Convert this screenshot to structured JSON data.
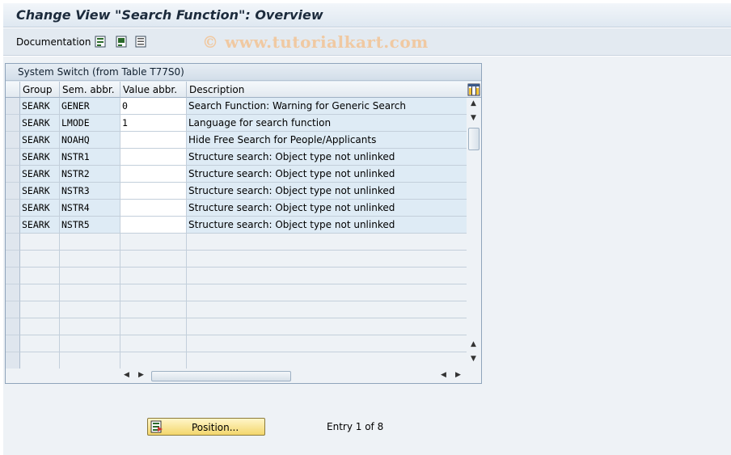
{
  "window": {
    "title": "Change View \"Search Function\": Overview"
  },
  "toolbar": {
    "documentation_label": "Documentation",
    "watermark": "© www.tutorialkart.com"
  },
  "table": {
    "title": "System Switch (from Table T77S0)",
    "columns": [
      "Group",
      "Sem. abbr.",
      "Value abbr.",
      "Description"
    ],
    "rows": [
      {
        "group": "SEARK",
        "sem": "GENER",
        "value": "0",
        "desc": "Search Function: Warning for Generic Search"
      },
      {
        "group": "SEARK",
        "sem": "LMODE",
        "value": "1",
        "desc": "Language for search function"
      },
      {
        "group": "SEARK",
        "sem": "NOAHQ",
        "value": "",
        "desc": "Hide Free Search for People/Applicants"
      },
      {
        "group": "SEARK",
        "sem": "NSTR1",
        "value": "",
        "desc": "Structure search: Object type not unlinked"
      },
      {
        "group": "SEARK",
        "sem": "NSTR2",
        "value": "",
        "desc": "Structure search: Object type not unlinked"
      },
      {
        "group": "SEARK",
        "sem": "NSTR3",
        "value": "",
        "desc": "Structure search: Object type not unlinked"
      },
      {
        "group": "SEARK",
        "sem": "NSTR4",
        "value": "",
        "desc": "Structure search: Object type not unlinked"
      },
      {
        "group": "SEARK",
        "sem": "NSTR5",
        "value": "",
        "desc": "Structure search: Object type not unlinked"
      }
    ]
  },
  "footer": {
    "position_label": "Position...",
    "entry_text": "Entry 1 of 8"
  }
}
